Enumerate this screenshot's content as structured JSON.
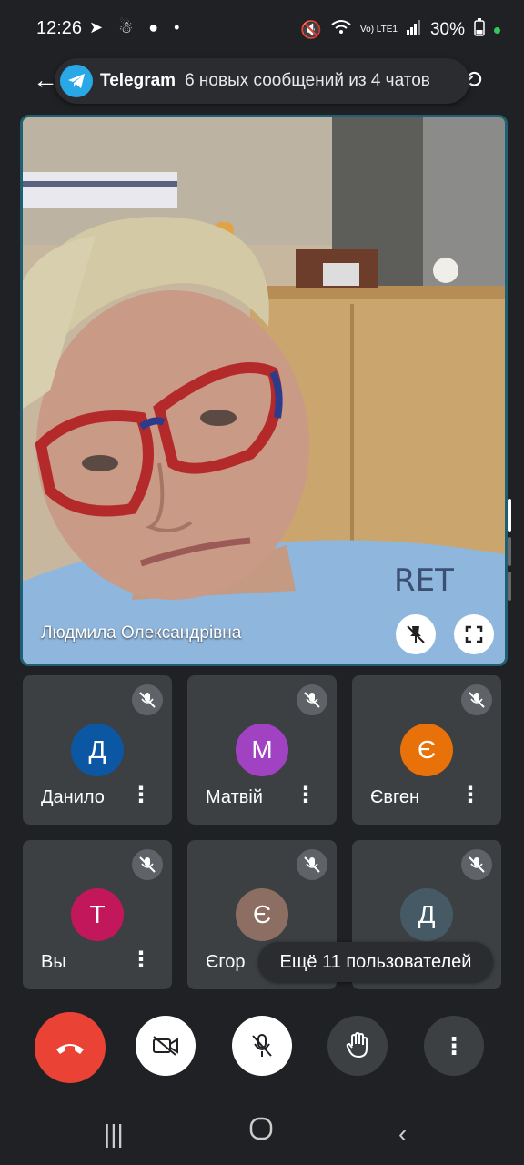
{
  "status_bar": {
    "time": "12:26",
    "notif_icons": "➤ ☃ ● •",
    "signal_text": "Vo) LTE1",
    "battery": "30%"
  },
  "notification": {
    "app": "Telegram",
    "message": "6 новых сообщений из 4 чатов"
  },
  "main_speaker": {
    "name": "Людмила Олександрівна"
  },
  "participants": [
    {
      "initial": "Д",
      "name": "Данило",
      "color": "#0b57a4"
    },
    {
      "initial": "М",
      "name": "Матвій",
      "color": "#a142c2"
    },
    {
      "initial": "Є",
      "name": "Євген",
      "color": "#e8710a"
    },
    {
      "initial": "Т",
      "name": "Вы",
      "color": "#c2185b"
    },
    {
      "initial": "Є",
      "name": "Єгор",
      "color": "#8d6e63"
    },
    {
      "initial": "Д",
      "name": "",
      "color": "#455a64"
    }
  ],
  "more_users": "Ещё 11 пользователей",
  "controls": [
    "end-call",
    "camera-off",
    "mic-off",
    "raise-hand",
    "more-options"
  ],
  "colors": {
    "accent_border": "#1f5f73",
    "end_call": "#ea4335",
    "tile_bg": "#3c4043"
  }
}
